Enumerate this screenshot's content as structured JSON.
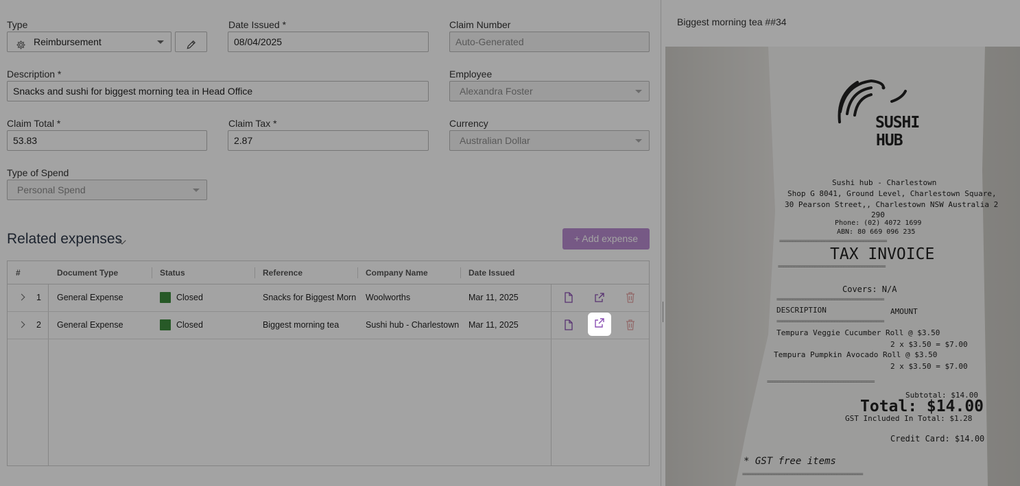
{
  "form": {
    "type_label": "Type",
    "type_value": "Reimbursement",
    "date_issued_label": "Date Issued *",
    "date_issued_value": "08/04/2025",
    "claim_number_label": "Claim Number",
    "claim_number_placeholder": "Auto-Generated",
    "description_label": "Description *",
    "description_value": "Snacks and sushi for biggest morning tea in Head Office",
    "employee_label": "Employee",
    "employee_value": "Alexandra Foster",
    "claim_total_label": "Claim Total *",
    "claim_total_value": "53.83",
    "claim_tax_label": "Claim Tax *",
    "claim_tax_value": "2.87",
    "currency_label": "Currency",
    "currency_value": "Australian Dollar",
    "type_of_spend_label": "Type of Spend",
    "type_of_spend_value": "Personal Spend"
  },
  "related": {
    "title": "Related expenses",
    "add_button": "+ Add expense",
    "columns": [
      "#",
      "Document Type",
      "Status",
      "Reference",
      "Company Name",
      "Date Issued"
    ],
    "rows": [
      {
        "num": "1",
        "doc_type": "General Expense",
        "status": "Closed",
        "reference": "Snacks for Biggest Morn",
        "company": "Woolworths",
        "date": "Mar 11, 2025"
      },
      {
        "num": "2",
        "doc_type": "General Expense",
        "status": "Closed",
        "reference": "Biggest morning tea",
        "company": "Sushi hub - Charlestown",
        "date": "Mar 11, 2025"
      }
    ]
  },
  "preview": {
    "title": "Biggest morning tea ##34",
    "receipt": {
      "brand1": "SUSHI",
      "brand2": "HUB",
      "store": "Sushi hub - Charlestown",
      "addr1": "Shop G 8041, Ground Level, Charlestown Square,",
      "addr2": "30 Pearson Street,, Charlestown  NSW Australia 2",
      "addr3": "290",
      "phone": "Phone: (02) 4072 1699",
      "abn": "ABN: 80 669 096 235",
      "heading": "TAX INVOICE",
      "covers": "Covers: N/A",
      "col_desc": "DESCRIPTION",
      "col_amount": "AMOUNT",
      "item1": "Tempura Veggie Cucumber Roll @ $3.50",
      "item1_qty": "2 x   $3.50 = $7.00",
      "item2": "Tempura Pumpkin Avocado Roll @ $3.50",
      "item2_qty": "2 x   $3.50 = $7.00",
      "subtotal": "Subtotal: $14.00",
      "total": "Total: $14.00",
      "gst": "GST Included In Total:  $1.28",
      "credit": "Credit Card: $14.00",
      "gst_free": "* GST free items",
      "rule": "=========================================",
      "rule_long": "=============================================="
    }
  },
  "colors": {
    "accent": "#b98bd1",
    "status_closed": "#3d8b3d",
    "icon_purple": "#8a4fb3",
    "delete_red": "#e3a3a3"
  }
}
